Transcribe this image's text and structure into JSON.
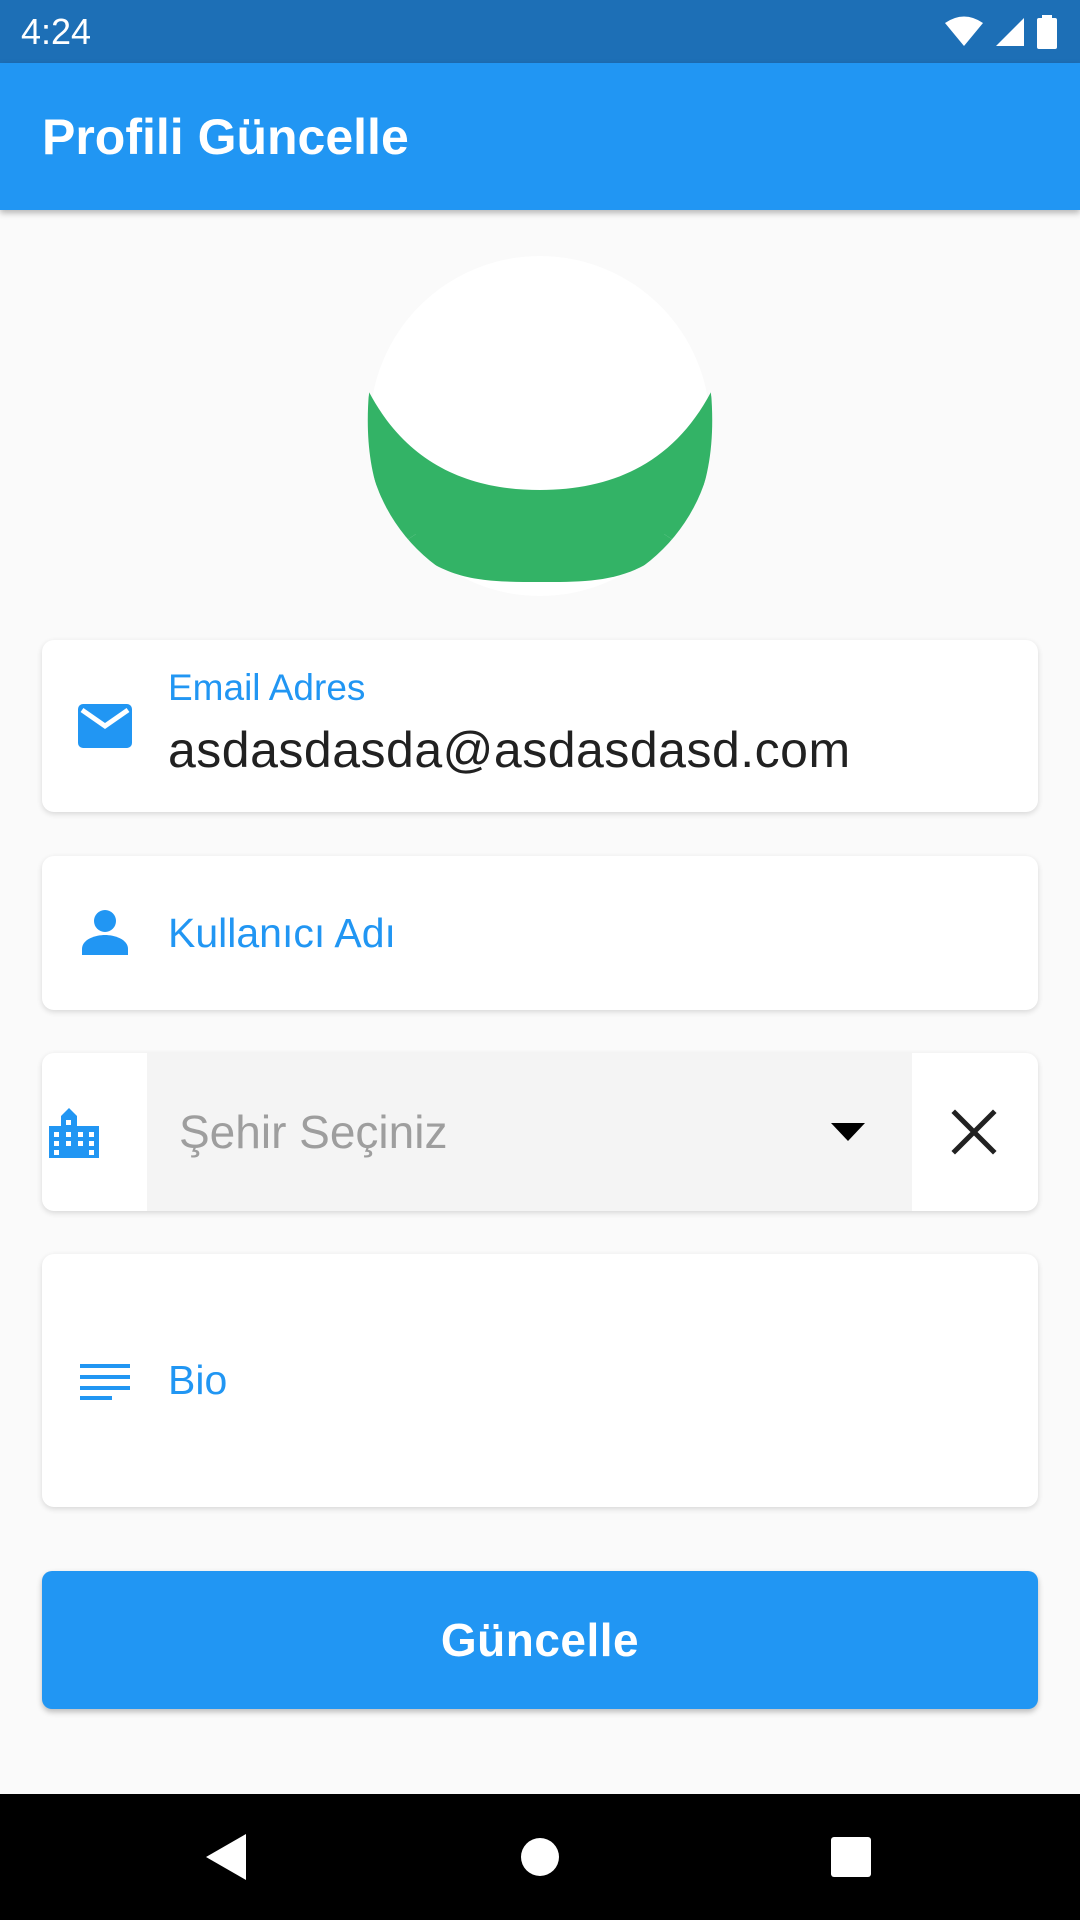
{
  "status_bar": {
    "time": "4:24",
    "icons": [
      "wifi-icon",
      "signal-icon",
      "battery-icon"
    ]
  },
  "app_bar": {
    "title": "Profili Güncelle",
    "color": "#2196f3"
  },
  "avatar": {
    "icon": "avatar-image",
    "colors": [
      "#ffffff",
      "#33b366"
    ]
  },
  "form": {
    "email": {
      "icon": "mail-icon",
      "label": "Email Adres",
      "value": "asdasdasda@asdasdasd.com"
    },
    "username": {
      "icon": "person-icon",
      "label": "Kullanıcı Adı",
      "value": ""
    },
    "city": {
      "icon": "city-icon",
      "placeholder": "Şehir Seçiniz",
      "dropdown_icon": "dropdown-arrow-icon",
      "clear_icon": "close-icon"
    },
    "bio": {
      "icon": "notes-icon",
      "label": "Bio",
      "value": ""
    }
  },
  "actions": {
    "update_label": "Güncelle"
  },
  "nav_bar": {
    "icons": [
      "back-icon",
      "home-icon",
      "recents-icon"
    ]
  }
}
